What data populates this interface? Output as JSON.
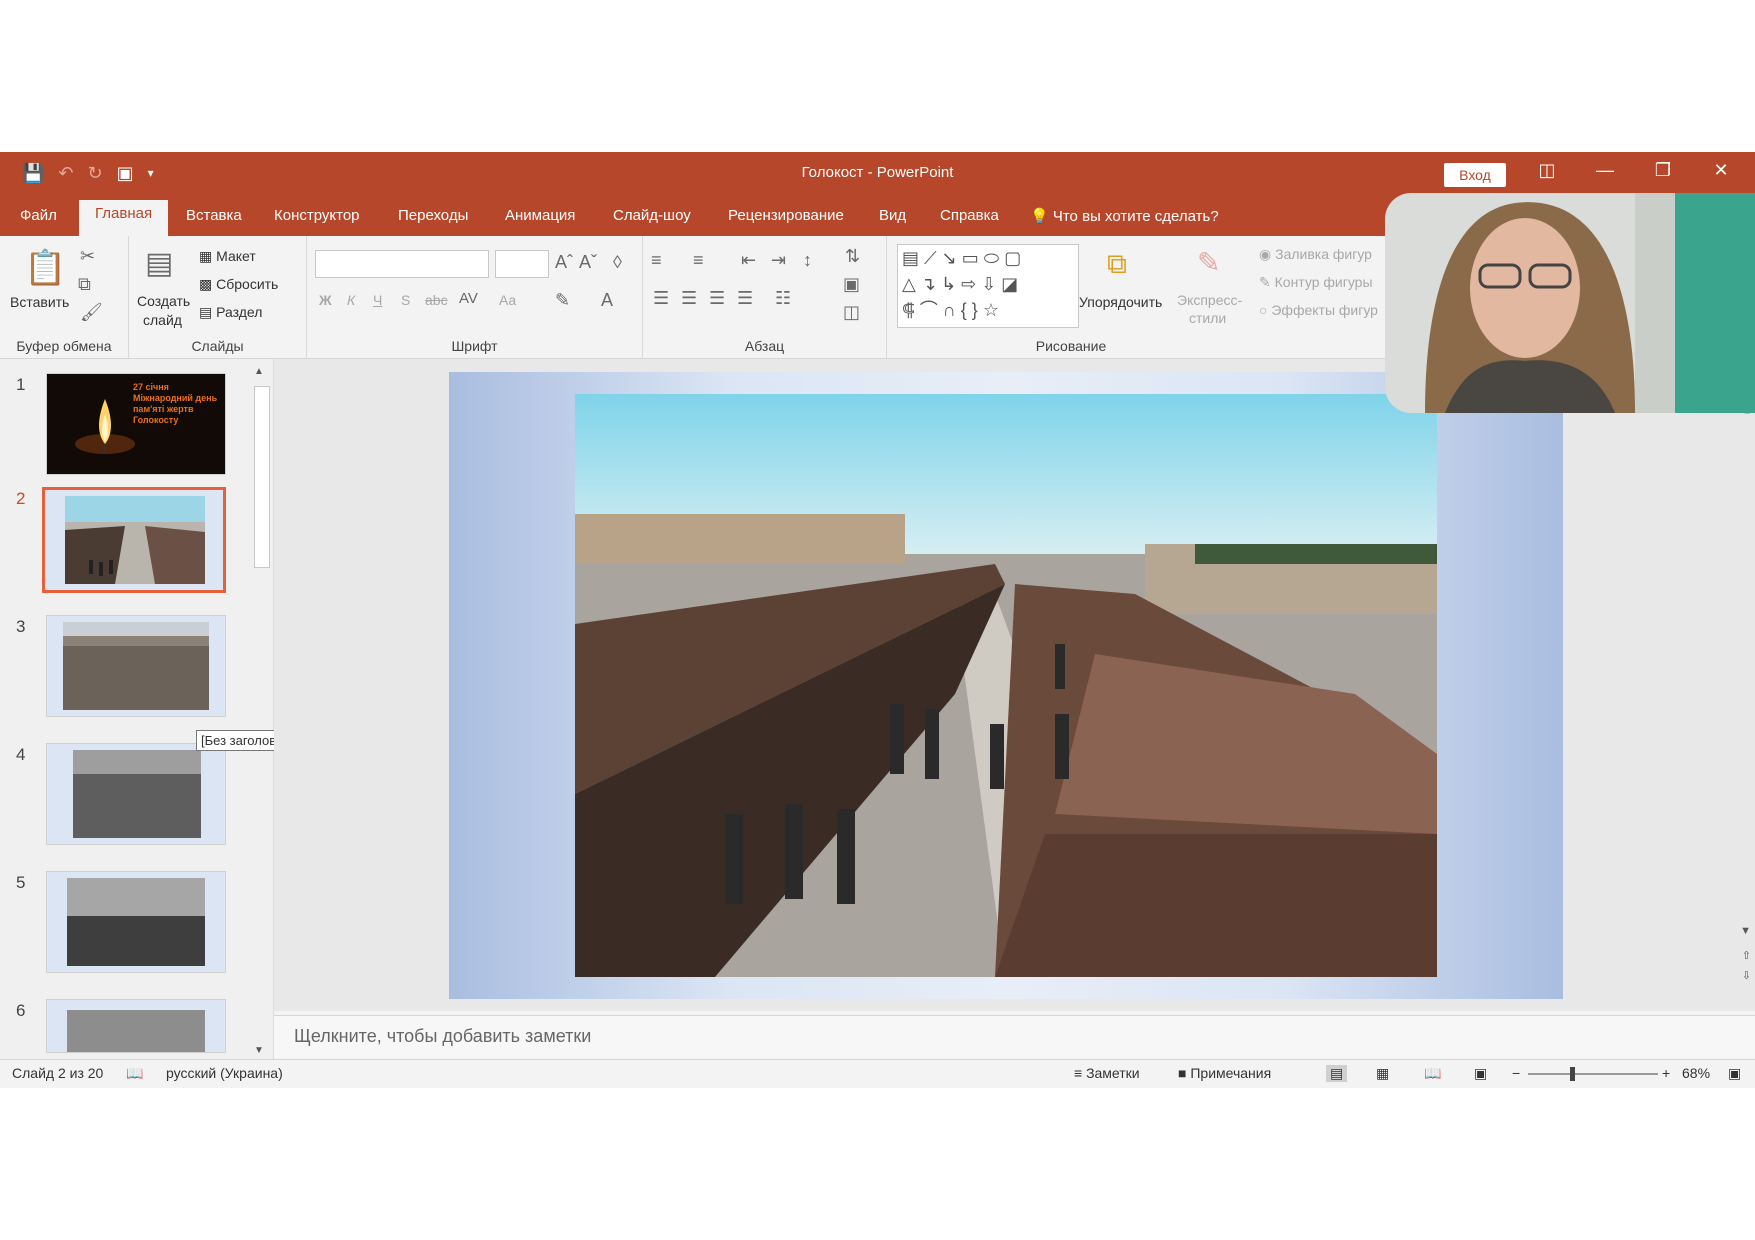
{
  "window": {
    "title": "Голокост  -  PowerPoint",
    "signin_label": "Вход"
  },
  "menu": {
    "tabs": [
      "Файл",
      "Главная",
      "Вставка",
      "Конструктор",
      "Переходы",
      "Анимация",
      "Слайд-шоу",
      "Рецензирование",
      "Вид",
      "Справка"
    ],
    "active_tab": "Главная",
    "tell_me": "Что вы хотите сделать?"
  },
  "ribbon": {
    "clipboard": {
      "paste_label": "Вставить",
      "group_label": "Буфер обмена"
    },
    "slides": {
      "new_slide_line1": "Создать",
      "new_slide_line2": "слайд",
      "layout_label": "Макет",
      "reset_label": "Сбросить",
      "section_label": "Раздел",
      "group_label": "Слайды"
    },
    "font": {
      "group_label": "Шрифт",
      "bold": "Ж",
      "italic": "К",
      "underline": "Ч",
      "shadow": "S",
      "strike": "abc",
      "case": "Aa"
    },
    "paragraph": {
      "group_label": "Абзац"
    },
    "drawing": {
      "group_label": "Рисование",
      "arrange_label": "Упорядочить",
      "quick_styles_line1": "Экспресс-",
      "quick_styles_line2": "стили",
      "shape_fill": "Заливка фигур",
      "shape_outline": "Контур фигуры",
      "shape_effects": "Эффекты фигур"
    }
  },
  "thumbnails": [
    {
      "number": "1",
      "text": "27 січня Міжнародний день пам'яті жертв Голокосту"
    },
    {
      "number": "2",
      "selected": true
    },
    {
      "number": "3"
    },
    {
      "number": "4"
    },
    {
      "number": "5"
    },
    {
      "number": "6"
    }
  ],
  "tooltip": "[Без заголовка]",
  "notes_placeholder": "Щелкните, чтобы добавить заметки",
  "status": {
    "slide_info": "Слайд 2 из 20",
    "language": "русский (Украина)",
    "notes_label": "Заметки",
    "comments_label": "Примечания",
    "zoom": "68%"
  },
  "colors": {
    "accent": "#b7472a",
    "selection": "#e8603a"
  }
}
